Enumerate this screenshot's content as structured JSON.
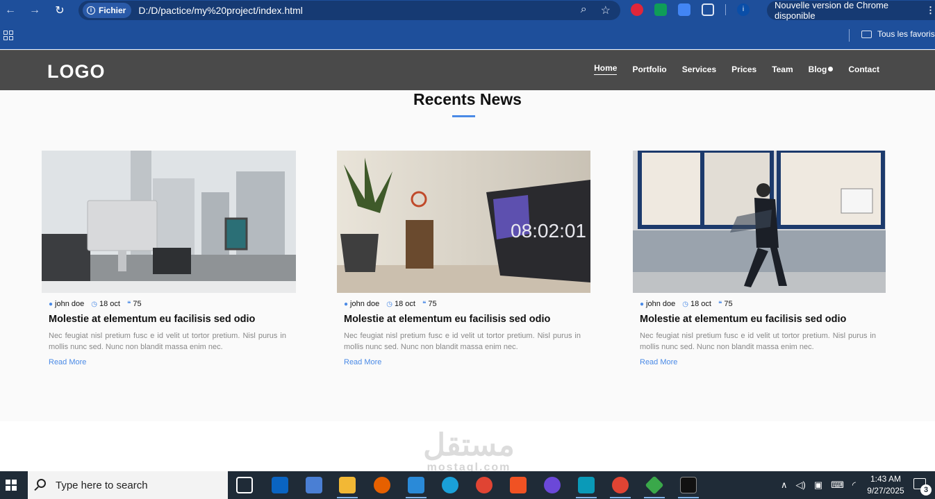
{
  "browser": {
    "chip_label": "Fichier",
    "url": "D:/D/pactice/my%20project/index.html",
    "update_notice": "Nouvelle version de Chrome disponible",
    "bookmarks_folder": "Tous les favoris"
  },
  "site": {
    "logo": "LOGO",
    "nav": [
      {
        "label": "Home"
      },
      {
        "label": "Portfolio"
      },
      {
        "label": "Services"
      },
      {
        "label": "Prices"
      },
      {
        "label": "Team"
      },
      {
        "label": "Blog"
      },
      {
        "label": "Contact"
      }
    ],
    "section_title": "Recents News",
    "cards": [
      {
        "image": "office-desk-photo",
        "author": "john doe",
        "date": "18 oct",
        "comments": "75",
        "title": "Molestie at elementum eu facilisis sed odio",
        "excerpt": "Nec feugiat nisl pretium fusc e id velit ut tortor pretium. Nisl purus in mollis nunc sed. Nunc non blandit massa enim nec.",
        "read_more": "Read More"
      },
      {
        "image": "laptop-clock-photo",
        "author": "john doe",
        "date": "18 oct",
        "comments": "75",
        "title": "Molestie at elementum eu facilisis sed odio",
        "excerpt": "Nec feugiat nisl pretium fusc e id velit ut tortor pretium. Nisl purus in mollis nunc sed. Nunc non blandit massa enim nec.",
        "read_more": "Read More"
      },
      {
        "image": "businessman-walking-photo",
        "author": "john doe",
        "date": "18 oct",
        "comments": "75",
        "title": "Molestie at elementum eu facilisis sed odio",
        "excerpt": "Nec feugiat nisl pretium fusc e id velit ut tortor pretium. Nisl purus in mollis nunc sed. Nunc non blandit massa enim nec.",
        "read_more": "Read More"
      }
    ]
  },
  "watermark": {
    "text": "مستقل",
    "sub": "mostaql.com"
  },
  "taskbar": {
    "search_placeholder": "Type here to search",
    "time": "1:43 AM",
    "date": "9/27/2025",
    "notification_count": "3"
  },
  "colors": {
    "accent": "#4a8ae6",
    "header_bg": "#4a4a4a",
    "chrome_bg": "#1e4f9b",
    "taskbar_bg": "#1f2b37"
  }
}
